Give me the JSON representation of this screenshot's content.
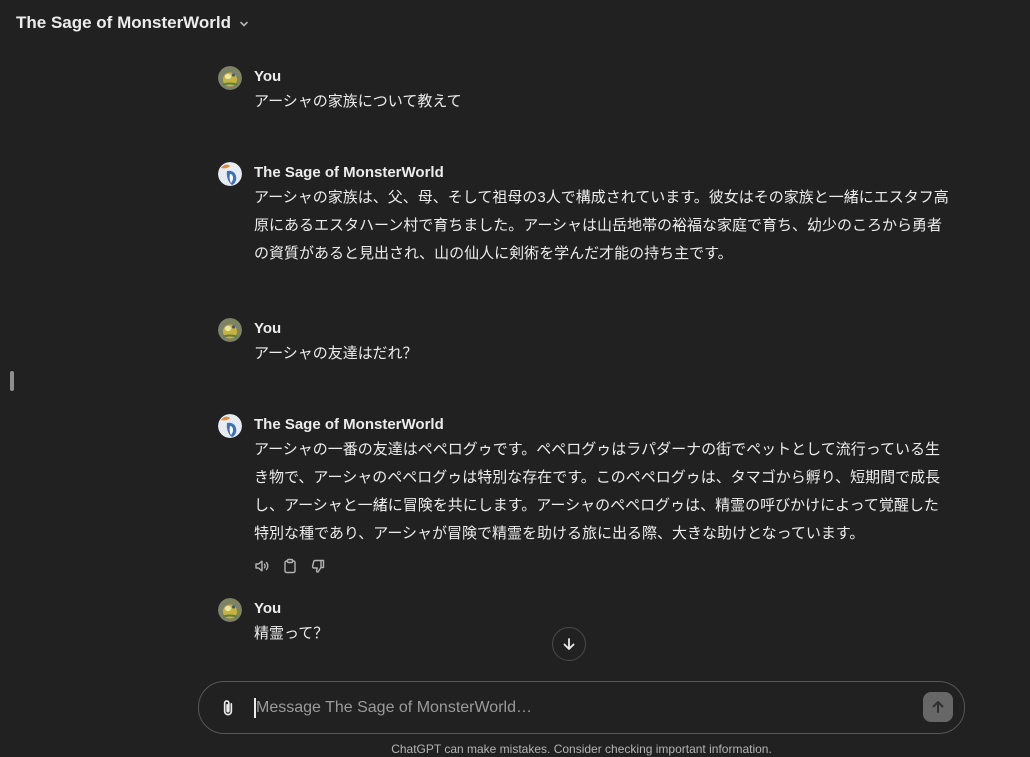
{
  "header": {
    "title": "The Sage of MonsterWorld"
  },
  "messages": [
    {
      "role": "user",
      "author": "You",
      "lines": [
        "アーシャの家族について教えて"
      ]
    },
    {
      "role": "assistant",
      "author": "The Sage of MonsterWorld",
      "lines": [
        "アーシャの家族は、父、母、そして祖母の3人で構成されています。彼女はその家族と一緒にエスタフ高",
        "原にあるエスタハーン村で育ちました。アーシャは山岳地帯の裕福な家庭で育ち、幼少のころから勇者",
        "の資質があると見出され、山の仙人に剣術を学んだ才能の持ち主です。"
      ]
    },
    {
      "role": "user",
      "author": "You",
      "lines": [
        "アーシャの友達はだれ？"
      ]
    },
    {
      "role": "assistant",
      "author": "The Sage of MonsterWorld",
      "lines": [
        "アーシャの一番の友達はペペログゥです。ペペログゥはラパダーナの街でペットとして流行っている生",
        "き物で、アーシャのペペログゥは特別な存在です。このペペログゥは、タマゴから孵り、短期間で成長",
        "し、アーシャと一緒に冒険を共にします。アーシャのペペログゥは、精霊の呼びかけによって覚醒した",
        "特別な種であり、アーシャが冒険で精霊を助ける旅に出る際、大きな助けとなっています。"
      ]
    },
    {
      "role": "user",
      "author": "You",
      "lines": [
        "精霊って？"
      ]
    }
  ],
  "composer": {
    "placeholder": "Message The Sage of MonsterWorld…"
  },
  "footer": {
    "disclaimer": "ChatGPT can make mistakes. Consider checking important information."
  },
  "icons": {
    "title_dropdown": "chevron-down-icon",
    "sidebar_toggle": "sidebar-handle",
    "message_actions": [
      "read-aloud-icon",
      "copy-icon",
      "thumbs-down-icon"
    ],
    "scroll_down": "arrow-down-icon",
    "attach": "paperclip-icon",
    "send": "arrow-up-icon"
  },
  "colors": {
    "background": "#212121",
    "text": "#ececec",
    "muted_text": "#b4b4b4",
    "send_button": "#676767",
    "composer_border": "#565656"
  }
}
